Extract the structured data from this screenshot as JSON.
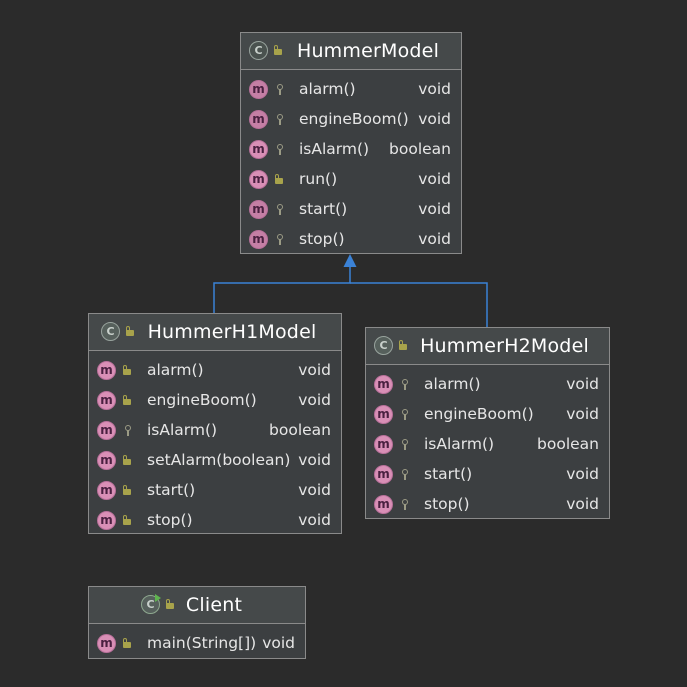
{
  "colors": {
    "background": "#2b2b2b",
    "box": "#3c3f41",
    "connector": "#3b82d6",
    "method_icon": "#d98fb6"
  },
  "classes": {
    "hummer_model": {
      "name": "HummerModel",
      "icon": "abstract-class-icon",
      "methods": [
        {
          "name": "alarm()",
          "type": "void",
          "visibility": "protected",
          "abstract": true
        },
        {
          "name": "engineBoom()",
          "type": "void",
          "visibility": "protected",
          "abstract": true
        },
        {
          "name": "isAlarm()",
          "type": "boolean",
          "visibility": "protected",
          "abstract": false
        },
        {
          "name": "run()",
          "type": "void",
          "visibility": "public",
          "abstract": false
        },
        {
          "name": "start()",
          "type": "void",
          "visibility": "protected",
          "abstract": true
        },
        {
          "name": "stop()",
          "type": "void",
          "visibility": "protected",
          "abstract": true
        }
      ]
    },
    "hummer_h1": {
      "name": "HummerH1Model",
      "icon": "class-icon",
      "methods": [
        {
          "name": "alarm()",
          "type": "void",
          "visibility": "public"
        },
        {
          "name": "engineBoom()",
          "type": "void",
          "visibility": "public"
        },
        {
          "name": "isAlarm()",
          "type": "boolean",
          "visibility": "protected"
        },
        {
          "name": "setAlarm(boolean)",
          "type": "void",
          "visibility": "public"
        },
        {
          "name": "start()",
          "type": "void",
          "visibility": "public"
        },
        {
          "name": "stop()",
          "type": "void",
          "visibility": "public"
        }
      ]
    },
    "hummer_h2": {
      "name": "HummerH2Model",
      "icon": "class-icon",
      "methods": [
        {
          "name": "alarm()",
          "type": "void",
          "visibility": "protected"
        },
        {
          "name": "engineBoom()",
          "type": "void",
          "visibility": "protected"
        },
        {
          "name": "isAlarm()",
          "type": "boolean",
          "visibility": "protected"
        },
        {
          "name": "start()",
          "type": "void",
          "visibility": "protected"
        },
        {
          "name": "stop()",
          "type": "void",
          "visibility": "protected"
        }
      ]
    },
    "client": {
      "name": "Client",
      "icon": "runnable-class-icon",
      "methods": [
        {
          "name": "main(String[])",
          "type": "void",
          "visibility": "public"
        }
      ]
    }
  },
  "relations": [
    {
      "type": "inheritance",
      "from": "HummerH1Model",
      "to": "HummerModel"
    },
    {
      "type": "inheritance",
      "from": "HummerH2Model",
      "to": "HummerModel"
    }
  ]
}
